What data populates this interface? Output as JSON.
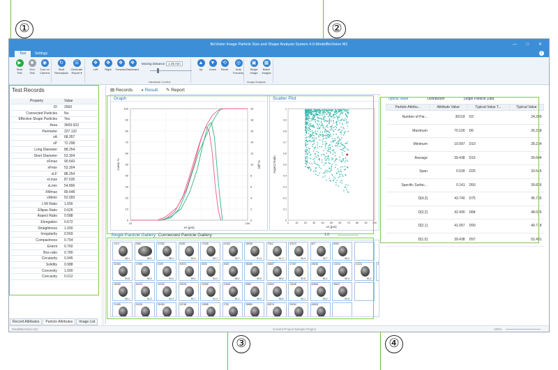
{
  "window": {
    "title": "BeVision Image Particle Size and Shape Analysis System 4.0-ModelBeVision M1",
    "controls": "— □ ✕"
  },
  "ribbon": {
    "tabs": [
      "Test",
      "Settings"
    ],
    "buttons": [
      {
        "label": "Start\nTest",
        "icon": "▶",
        "icon_name": "play-icon",
        "color": "#27a844"
      },
      {
        "label": "End\nTest",
        "icon": "■",
        "icon_name": "stop-icon",
        "color": "#9aa3ad"
      },
      {
        "label": "Turn on\nCamera",
        "icon": "◉",
        "icon_name": "camera-icon",
        "color": "#2f7fd0"
      },
      {
        "label": "Start\nReanalysis",
        "icon": "↻",
        "icon_name": "reanalysis-icon",
        "color": "#2f7fd0"
      },
      {
        "label": "Generate\nReport ▾",
        "icon": "☰",
        "icon_name": "report-icon",
        "color": "#2f7fd0"
      },
      {
        "label": "Left",
        "icon": "✥",
        "icon_name": "move-left-icon",
        "color": "#2f7fd0"
      },
      {
        "label": "Right",
        "icon": "✥",
        "icon_name": "move-right-icon",
        "color": "#2f7fd0"
      },
      {
        "label": "Forward",
        "icon": "✥",
        "icon_name": "move-forward-icon",
        "color": "#2f7fd0"
      },
      {
        "label": "Backward",
        "icon": "✥",
        "icon_name": "move-backward-icon",
        "color": "#2f7fd0"
      },
      {
        "label": "Up",
        "icon": "▲",
        "icon_name": "up-icon",
        "color": "#2f7fd0"
      },
      {
        "label": "Down",
        "icon": "▼",
        "icon_name": "down-icon",
        "color": "#2f7fd0"
      },
      {
        "label": "Reset",
        "icon": "⟲",
        "icon_name": "reset-icon",
        "color": "#2f7fd0"
      },
      {
        "label": "Auto\nFocusing",
        "icon": "◎",
        "icon_name": "focus-icon",
        "color": "#2f7fd0"
      },
      {
        "label": "Single\nImage",
        "icon": "▣",
        "icon_name": "single-image-icon",
        "color": "#2f7fd0"
      },
      {
        "label": "Batch\nImages",
        "icon": "▦",
        "icon_name": "batch-images-icon",
        "color": "#2f7fd0"
      }
    ],
    "moving_distance_label": "Moving Distance",
    "moving_distance_value": "1.05 mm",
    "groups": [
      "Hardware Control",
      "Image Analysis"
    ]
  },
  "left_panel": {
    "title": "Test Records",
    "headers": [
      "Property",
      "Value"
    ],
    "rows": [
      [
        "ID",
        "2560"
      ],
      [
        "Connected Particles",
        "No"
      ],
      [
        "Effective Shape Particles",
        "Yes"
      ],
      [
        "Area",
        "3669.933"
      ],
      [
        "Perimeter",
        "227.132"
      ],
      [
        "xA",
        "68.357"
      ],
      [
        "xP",
        "72.298"
      ],
      [
        "Long Diameter",
        "88.254"
      ],
      [
        "Short Diameter",
        "53.304"
      ],
      [
        "xFmax",
        "90.643"
      ],
      [
        "xFmin",
        "53.304"
      ],
      [
        "xLF",
        "88.254"
      ],
      [
        "xLmax",
        "87.635"
      ],
      [
        "xLmin",
        "54.896"
      ],
      [
        "XMmax",
        "89.648"
      ],
      [
        "xMmin",
        "52.093"
      ],
      [
        "L/W Ratio",
        "1.656"
      ],
      [
        "Ellipse Ratio",
        "0.626"
      ],
      [
        "Aspect Ratio",
        "0.588"
      ],
      [
        "Elongation",
        "0.672"
      ],
      [
        "Straightness",
        "1.000"
      ],
      [
        "Irregularity",
        "0.569"
      ],
      [
        "Compactness",
        "0.754"
      ],
      [
        "Extent",
        "0.760"
      ],
      [
        "Box ratio",
        "0.780"
      ],
      [
        "Circularity",
        "0.945"
      ],
      [
        "Solidity",
        "0.988"
      ],
      [
        "Convexity",
        "1.000"
      ],
      [
        "Concavity",
        "0.012"
      ]
    ],
    "bottom_tabs": [
      "Record Attributes",
      "Particle Attributes",
      "Image List"
    ]
  },
  "center": {
    "tabs": [
      "Records",
      "Result",
      "Report"
    ],
    "graph": {
      "title": "Graph"
    },
    "scatter": {
      "title": "Scatter Plot"
    },
    "gallery_tabs": [
      "Single Particle Gallery",
      "Connected Particle Gallery"
    ],
    "gallery_scale": "1:6",
    "gallery_rows": [
      [
        [
          "1474",
          "48.1"
        ],
        [
          "2560",
          "68.4"
        ],
        [
          "37250",
          "58.4"
        ],
        [
          "5185",
          "53.9"
        ],
        [
          "17926",
          "63.7"
        ],
        [
          "14181",
          "53.7"
        ],
        [
          "18095",
          "51.4"
        ],
        [
          "7064",
          "61.3"
        ],
        [
          "47673",
          "56.9"
        ],
        [
          "807",
          "49.7"
        ],
        [
          "6953",
          "56.2"
        ],
        [
          "",
          ""
        ]
      ],
      [
        [
          "32463",
          "59.8"
        ],
        [
          "17589",
          "56.5"
        ],
        [
          "6199",
          "54.4"
        ],
        [
          "30921",
          "59.4"
        ],
        [
          "8030",
          "54.3"
        ],
        [
          "3049",
          "58.2"
        ],
        [
          "36385",
          "59.6"
        ],
        [
          "36587",
          "56.8"
        ],
        [
          "47457",
          "53.8"
        ],
        [
          "25630",
          "56.2"
        ],
        [
          "12216",
          "56.4"
        ],
        [
          "21321",
          "54.2"
        ],
        [
          "33226",
          ""
        ]
      ],
      [
        [
          "18499",
          "56.1"
        ],
        [
          "34423",
          "52.3"
        ],
        [
          "11633",
          "53.3"
        ],
        [
          "29978",
          "50.7"
        ],
        [
          "33396",
          "51.0"
        ],
        [
          "10463",
          "62.1"
        ],
        [
          "6989",
          "55.0"
        ],
        [
          "22841",
          "56.5"
        ],
        [
          "13648",
          "54.1"
        ],
        [
          "40896",
          "59.0"
        ],
        [
          "35627",
          "53.5"
        ],
        [
          "",
          ""
        ]
      ],
      [
        [
          "21495",
          ""
        ],
        [
          "24339",
          ""
        ],
        [
          "30459",
          ""
        ],
        [
          "26748",
          ""
        ],
        [
          "19585",
          ""
        ],
        [
          "1752",
          ""
        ],
        [
          "26883",
          ""
        ],
        [
          "45574",
          ""
        ],
        [
          "20094",
          ""
        ],
        [
          "45063",
          ""
        ],
        [
          "",
          ""
        ]
      ]
    ]
  },
  "chart_data": [
    {
      "type": "line",
      "title": "Graph",
      "xlabel": "xA [μm]",
      "ylabel": "Cumu %",
      "ylabel_right": "Diff %",
      "xscale": "log",
      "xlim": [
        10,
        100
      ],
      "ylim": [
        0,
        100
      ],
      "ylim_right": [
        0,
        20
      ],
      "xticks": [
        "10",
        "100"
      ],
      "yticks": [
        "0",
        "10",
        "20",
        "30",
        "40",
        "50",
        "60",
        "70",
        "80",
        "90",
        "100"
      ],
      "yticks_right": [
        "0",
        "2",
        "4",
        "6",
        "8",
        "10",
        "12",
        "14",
        "16",
        "18",
        "20"
      ],
      "series": [
        {
          "color": "#2fb57f",
          "points": [
            [
              10,
              0
            ],
            [
              18,
              0
            ],
            [
              22,
              2
            ],
            [
              26,
              10
            ],
            [
              30,
              26
            ],
            [
              34,
              44
            ],
            [
              38,
              60
            ],
            [
              43,
              73
            ],
            [
              48,
              84
            ],
            [
              53,
              93
            ],
            [
              58,
              99
            ],
            [
              62,
              100
            ],
            [
              100,
              100
            ]
          ]
        },
        {
          "color": "#ea5a8a",
          "points": [
            [
              10,
              0
            ],
            [
              18,
              0
            ],
            [
              20,
              1
            ],
            [
              24,
              8
            ],
            [
              28,
              21
            ],
            [
              32,
              40
            ],
            [
              36,
              58
            ],
            [
              40,
              73
            ],
            [
              45,
              86
            ],
            [
              50,
              94
            ],
            [
              55,
              98
            ],
            [
              60,
              100
            ],
            [
              100,
              100
            ]
          ]
        },
        {
          "color": "#2fb57f",
          "axis": "right",
          "points": [
            [
              18,
              0
            ],
            [
              22,
              0.6
            ],
            [
              27,
              2
            ],
            [
              32,
              5
            ],
            [
              37,
              9
            ],
            [
              42,
              14
            ],
            [
              46,
              17
            ],
            [
              49,
              17.5
            ],
            [
              52,
              15
            ],
            [
              55,
              9
            ],
            [
              58,
              4
            ],
            [
              61,
              0
            ]
          ]
        },
        {
          "color": "#ea5a8a",
          "axis": "right",
          "points": [
            [
              17,
              0
            ],
            [
              20,
              0.6
            ],
            [
              25,
              2.3
            ],
            [
              30,
              5.5
            ],
            [
              35,
              10
            ],
            [
              40,
              14.5
            ],
            [
              44,
              16.8
            ],
            [
              47,
              16
            ],
            [
              50,
              12
            ],
            [
              53,
              6
            ],
            [
              56,
              2
            ],
            [
              59,
              0
            ]
          ]
        }
      ]
    },
    {
      "type": "scatter",
      "title": "Scatter Plot",
      "xlabel": "xA [μm]",
      "ylabel": "Aspect Ratio",
      "xlim": [
        0,
        100
      ],
      "ylim": [
        0,
        1
      ],
      "xticks": [
        "0",
        "10",
        "20",
        "30",
        "40",
        "50",
        "60",
        "70",
        "80",
        "90",
        "100"
      ],
      "yticks": [
        "0",
        "0.1",
        "0.2",
        "0.3",
        "0.4",
        "0.5",
        "0.6",
        "0.7",
        "0.8",
        "0.9",
        "1"
      ],
      "point_color": "#3bb9ad",
      "highlight": {
        "x": 68.357,
        "y": 0.588,
        "color": "#b22222"
      }
    }
  ],
  "right_panel": {
    "tabs": [
      "Typical Value",
      "Distribution",
      "Single Particle Data"
    ],
    "headers": [
      "Particle Attribu...",
      "Attribute Value",
      "Typical Value T...",
      "Typical Value"
    ],
    "rows": [
      [
        "Number of Par...",
        "30103",
        "D3",
        "24.209"
      ],
      [
        "Maximum",
        "70.100",
        "D6",
        "26.238"
      ],
      [
        "Minimum",
        "19.997",
        "D10",
        "28.234"
      ],
      [
        "Average",
        "39.438",
        "D16",
        "30.604"
      ],
      [
        "Span",
        "0.539",
        "D25",
        "33.545"
      ],
      [
        "Specific Surfac...",
        "0.141",
        "D50",
        "39.826"
      ],
      [
        "D[4,3]",
        "43.740",
        "D75",
        "45.735"
      ],
      [
        "D[3,2]",
        "42.490",
        "D84",
        "48.025"
      ],
      [
        "D[2,1]",
        "41.057",
        "D90",
        "49.718"
      ],
      [
        "D[1,0]",
        "39.438",
        "D97",
        "52.491"
      ]
    ]
  },
  "status": {
    "left": "ModelBeVision M1",
    "center": "Current Project:Sample Project",
    "zoom": "100%"
  },
  "callouts": [
    "①",
    "②",
    "③",
    "④"
  ],
  "colors": {
    "accent": "#3c8fd7",
    "highlight": "#7cc94b"
  }
}
